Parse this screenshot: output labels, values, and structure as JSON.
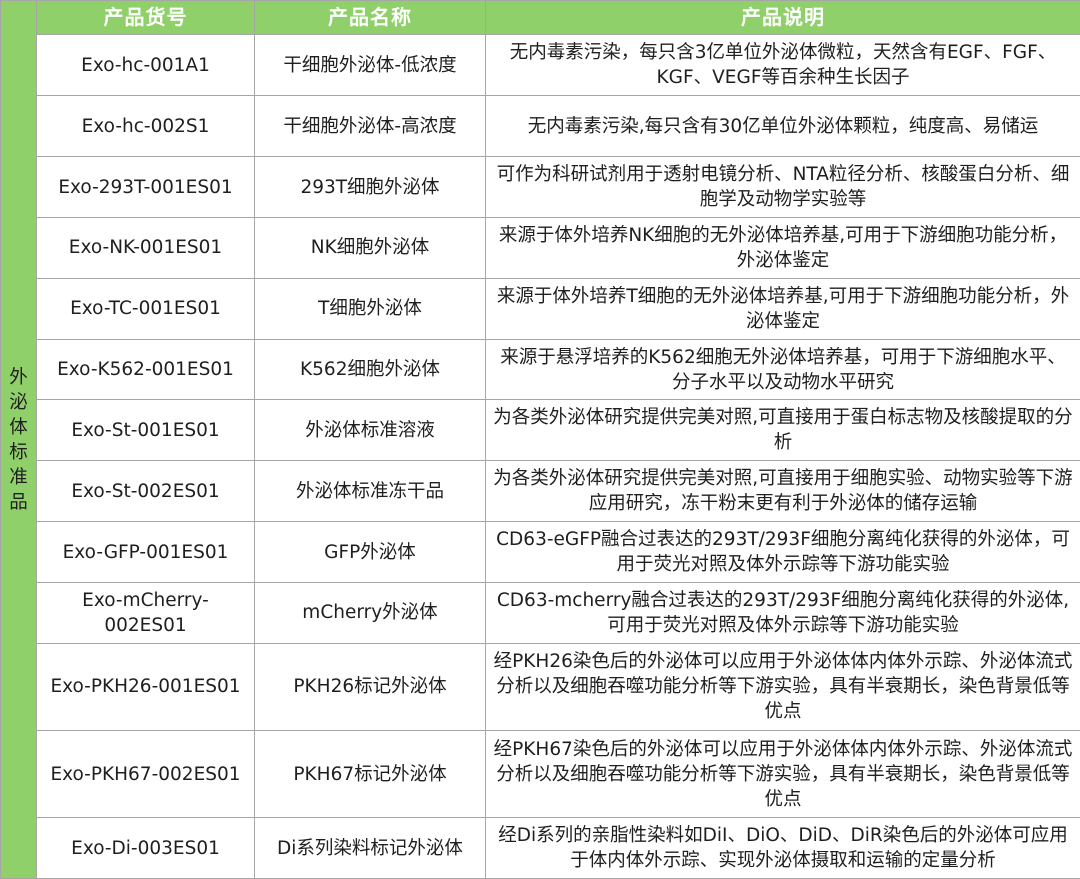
{
  "table": {
    "side_label": [
      "外",
      "泌",
      "体",
      "标",
      "准",
      "品"
    ],
    "headers": {
      "code": "产品货号",
      "name": "产品名称",
      "desc": "产品说明"
    },
    "rows": [
      {
        "code": "Exo-hc-001A1",
        "name": "干细胞外泌体-低浓度",
        "desc": "无内毒素污染，每只含3亿单位外泌体微粒，天然含有EGF、FGF、KGF、VEGF等百余种生长因子"
      },
      {
        "code": "Exo-hc-002S1",
        "name": "干细胞外泌体-高浓度",
        "desc": "无内毒素污染,每只含有30亿单位外泌体颗粒，纯度高、易储运"
      },
      {
        "code": "Exo-293T-001ES01",
        "name": "293T细胞外泌体",
        "desc": "可作为科研试剂用于透射电镜分析、NTA粒径分析、核酸蛋白分析、细胞学及动物学实验等"
      },
      {
        "code": "Exo-NK-001ES01",
        "name": "NK细胞外泌体",
        "desc": "来源于体外培养NK细胞的无外泌体培养基,可用于下游细胞功能分析，外泌体鉴定"
      },
      {
        "code": "Exo-TC-001ES01",
        "name": "T细胞外泌体",
        "desc": "来源于体外培养T细胞的无外泌体培养基,可用于下游细胞功能分析，外泌体鉴定"
      },
      {
        "code": "Exo-K562-001ES01",
        "name": "K562细胞外泌体",
        "desc": "来源于悬浮培养的K562细胞无外泌体培养基，可用于下游细胞水平、分子水平以及动物水平研究"
      },
      {
        "code": "Exo-St-001ES01",
        "name": "外泌体标准溶液",
        "desc": "为各类外泌体研究提供完美对照,可直接用于蛋白标志物及核酸提取的分析"
      },
      {
        "code": "Exo-St-002ES01",
        "name": "外泌体标准冻干品",
        "desc": "为各类外泌体研究提供完美对照,可直接用于细胞实验、动物实验等下游应用研究，冻干粉末更有利于外泌体的储存运输"
      },
      {
        "code": "Exo-GFP-001ES01",
        "name": "GFP外泌体",
        "desc": "CD63-eGFP融合过表达的293T/293F细胞分离纯化获得的外泌体，可用于荧光对照及体外示踪等下游功能实验"
      },
      {
        "code": "Exo-mCherry-002ES01",
        "name": "mCherry外泌体",
        "desc": "CD63-mcherry融合过表达的293T/293F细胞分离纯化获得的外泌体,可用于荧光对照及体外示踪等下游功能实验"
      },
      {
        "code": "Exo-PKH26-001ES01",
        "name": "PKH26标记外泌体",
        "desc": "经PKH26染色后的外泌体可以应用于外泌体体内体外示踪、外泌体流式分析以及细胞吞噬功能分析等下游实验，具有半衰期长，染色背景低等优点"
      },
      {
        "code": "Exo-PKH67-002ES01",
        "name": "PKH67标记外泌体",
        "desc": "经PKH67染色后的外泌体可以应用于外泌体体内体外示踪、外泌体流式分析以及细胞吞噬功能分析等下游实验，具有半衰期长，染色背景低等优点"
      },
      {
        "code": "Exo-Di-003ES01",
        "name": "Di系列染料标记外泌体",
        "desc": "经Di系列的亲脂性染料如DiI、DiO、DiD、DiR染色后的外泌体可应用于体内体外示踪、实现外泌体摄取和运输的定量分析"
      }
    ]
  }
}
